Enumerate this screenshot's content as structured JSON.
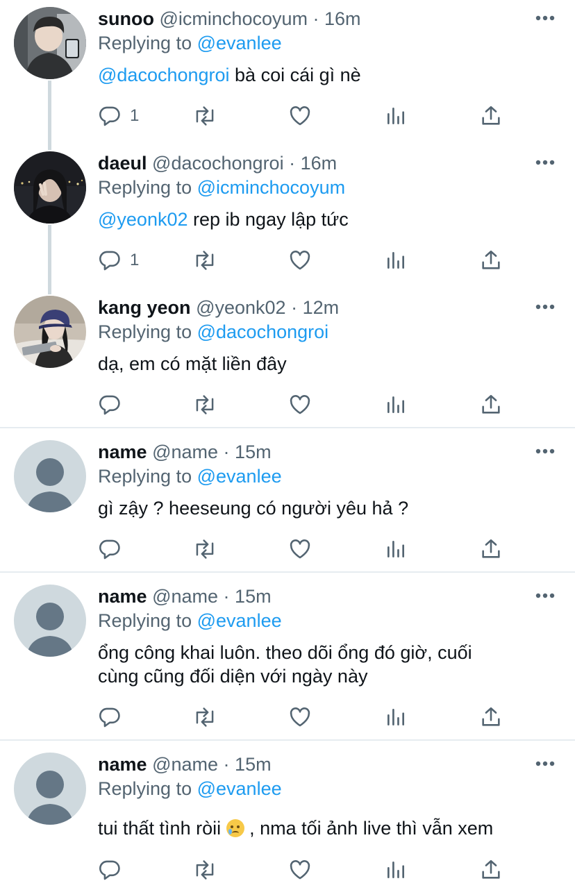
{
  "tweets": [
    {
      "name": "sunoo",
      "handle": "@icminchocoyum",
      "sep": "·",
      "time": "16m",
      "replying_label": "Replying to",
      "replying_to": "@evanlee",
      "mention": "@dacochongroi",
      "text": " bà coi cái gì nè",
      "reply_count": "1",
      "avatar": "photo-boy-mirror-selfie"
    },
    {
      "name": "daeul",
      "handle": "@dacochongroi",
      "sep": "·",
      "time": "16m",
      "replying_label": "Replying to",
      "replying_to": "@icminchocoyum",
      "mention": "@yeonk02",
      "text": " rep ib ngay lập tức",
      "reply_count": "1",
      "avatar": "photo-girl-night-city"
    },
    {
      "name": "kang yeon",
      "handle": "@yeonk02",
      "sep": "·",
      "time": "12m",
      "replying_label": "Replying to",
      "replying_to": "@dacochongroi",
      "text": "dạ, em có mặt liền đây",
      "avatar": "photo-girl-cap-tablet"
    },
    {
      "name": "name",
      "handle": "@name",
      "sep": "·",
      "time": "15m",
      "replying_label": "Replying to",
      "replying_to": "@evanlee",
      "text": "gì zậy ? heeseung có người yêu hả ?",
      "avatar": "default-avatar"
    },
    {
      "name": "name",
      "handle": "@name",
      "sep": "·",
      "time": "15m",
      "replying_label": "Replying to",
      "replying_to": "@evanlee",
      "text_line1": "ổng công khai luôn. theo dõi ổng đó giờ, cuối",
      "text_line2": "cùng cũng đối diện với ngày này",
      "avatar": "default-avatar"
    },
    {
      "name": "name",
      "handle": "@name",
      "sep": "·",
      "time": "15m",
      "replying_label": "Replying to",
      "replying_to": "@evanlee",
      "text_before_emoji": "tui thất tình ròii ",
      "emoji": "crying-face-emoji",
      "text_after_emoji": " , nma tối ảnh live thì vẫn xem",
      "avatar": "default-avatar"
    }
  ],
  "icons": {
    "reply": "reply-icon",
    "retweet": "retweet-icon",
    "like": "heart-icon",
    "analytics": "analytics-icon",
    "share": "share-icon",
    "more": "more-icon"
  },
  "colors": {
    "mention": "#1d9bf0",
    "secondary_text": "#536471",
    "thread_line": "#cfd9de",
    "divider": "#e6ecf0",
    "default_avatar_bg": "#cfd9de",
    "default_avatar_fg": "#657786"
  }
}
